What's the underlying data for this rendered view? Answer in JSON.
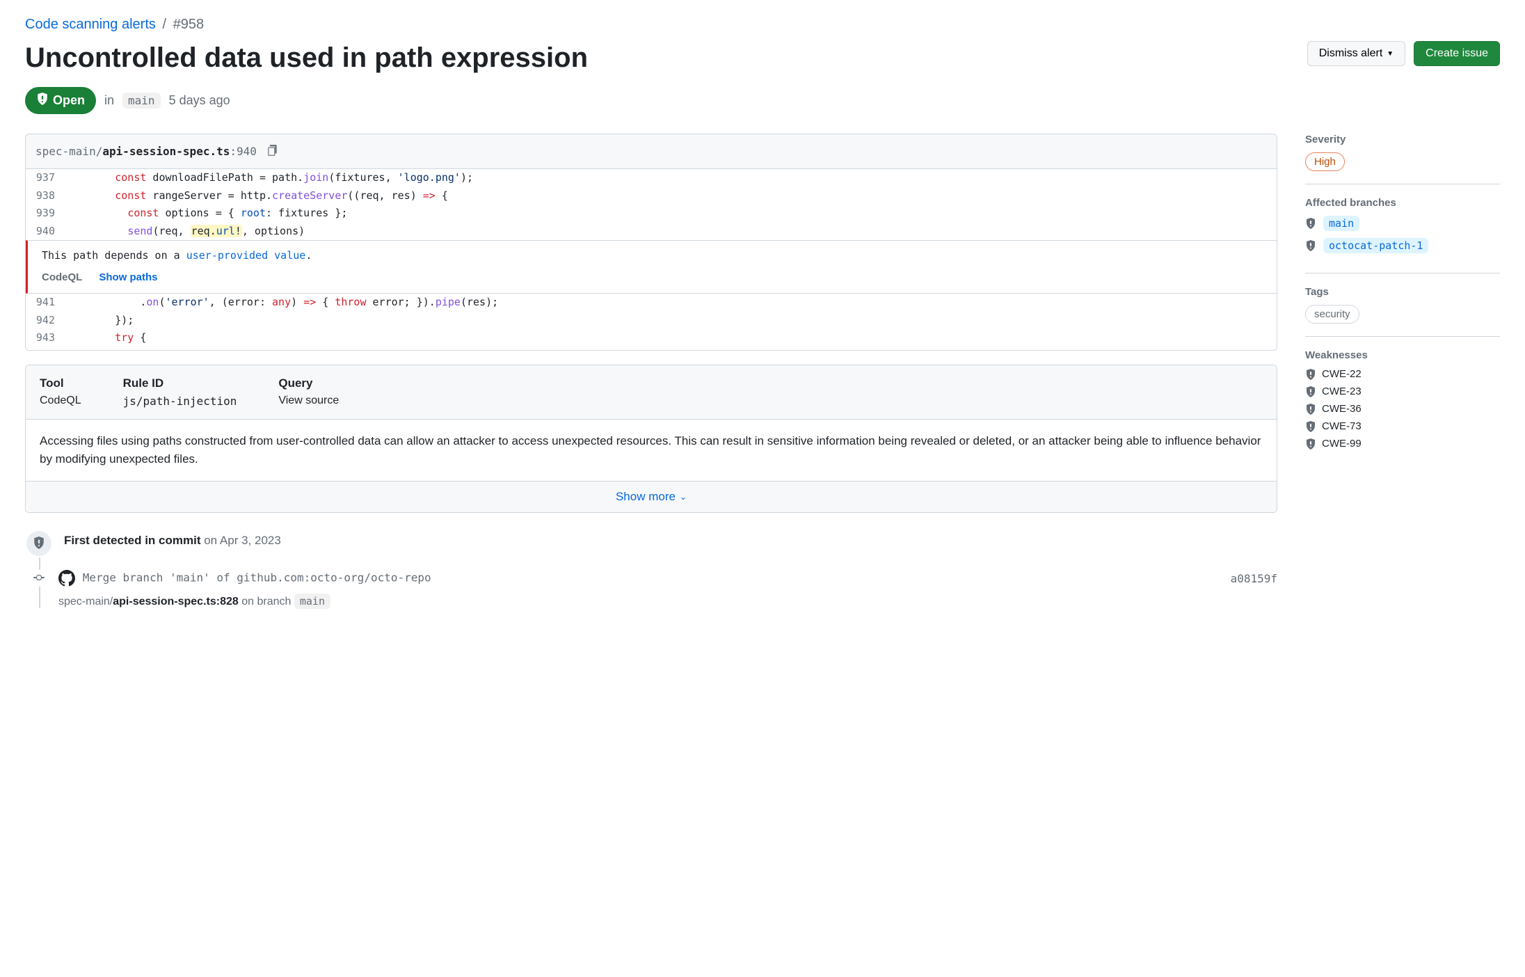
{
  "breadcrumb": {
    "parent": "Code scanning alerts",
    "separator": "/",
    "number": "#958"
  },
  "title": "Uncontrolled data used in path expression",
  "actions": {
    "dismiss": "Dismiss alert",
    "create_issue": "Create issue"
  },
  "status": {
    "state": "Open",
    "in": "in",
    "branch": "main",
    "when": "5 days ago"
  },
  "code": {
    "path_dir": "spec-main/",
    "path_file": "api-session-spec.ts",
    "path_suffix": ":940",
    "annotation": {
      "msg_pre": "This path depends on a ",
      "msg_link": "user-provided value",
      "msg_post": ".",
      "tool": "CodeQL",
      "show_paths": "Show paths"
    }
  },
  "info": {
    "cols": {
      "tool_label": "Tool",
      "tool_value": "CodeQL",
      "rule_label": "Rule ID",
      "rule_value": "js/path-injection",
      "query_label": "Query",
      "query_value": "View source"
    },
    "description": "Accessing files using paths constructed from user-controlled data can allow an attacker to access unexpected resources. This can result in sensitive information being revealed or deleted, or an attacker being able to influence behavior by modifying unexpected files.",
    "show_more": "Show more"
  },
  "timeline": {
    "first_detected_strong": "First detected in commit",
    "first_detected_when": "on Apr 3, 2023",
    "commit_msg": "Merge branch 'main' of github.com:octo-org/octo-repo",
    "commit_sha": "a08159f",
    "file_dir": "spec-main/",
    "file_name": "api-session-spec.ts:828",
    "on_branch_label": "on branch",
    "on_branch": "main"
  },
  "sidebar": {
    "severity_label": "Severity",
    "severity_value": "High",
    "branches_label": "Affected branches",
    "branches": [
      "main",
      "octocat-patch-1"
    ],
    "tags_label": "Tags",
    "tags": [
      "security"
    ],
    "weak_label": "Weaknesses",
    "weaknesses": [
      "CWE-22",
      "CWE-23",
      "CWE-36",
      "CWE-73",
      "CWE-99"
    ]
  }
}
